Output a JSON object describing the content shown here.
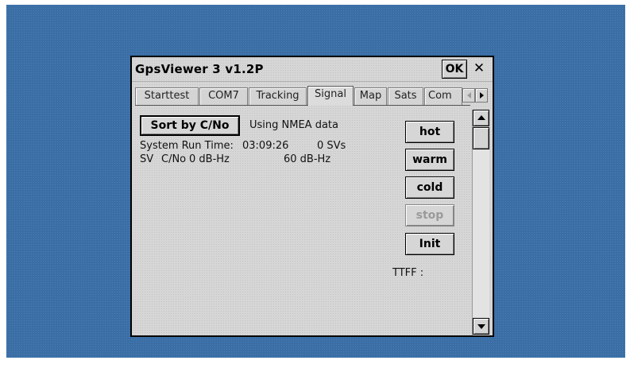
{
  "window": {
    "title": "GpsViewer 3 v1.2P",
    "ok_label": "OK",
    "close_label": "✕"
  },
  "tabs": [
    "Starttest",
    "COM7",
    "Tracking",
    "Signal",
    "Map",
    "Sats",
    "Com"
  ],
  "active_tab": "Signal",
  "signal": {
    "sort_button": "Sort by C/No",
    "data_source": "Using NMEA data",
    "run_time_label": "System Run Time:",
    "run_time": "03:09:26",
    "sv_count": "0 SVs",
    "sv_header": "SV",
    "cno_header": "C/No",
    "scale_min": "0 dB-Hz",
    "scale_max": "60 dB-Hz",
    "ttff_label": "TTFF :"
  },
  "controls": {
    "hot": "hot",
    "warm": "warm",
    "cold": "cold",
    "stop": "stop",
    "init": "Init"
  },
  "colors": {
    "desktop": "#3a6ea5",
    "window_bg": "#d6d6d6",
    "disabled_text": "#9a9a9a"
  }
}
